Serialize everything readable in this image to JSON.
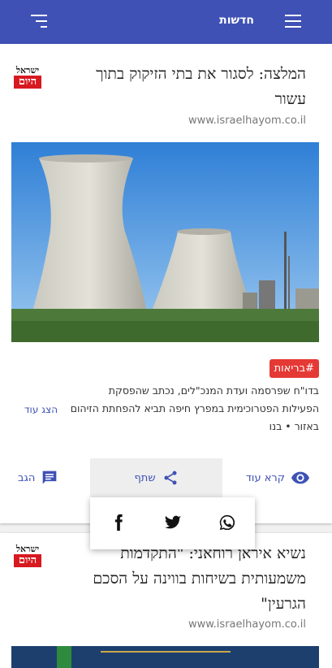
{
  "header": {
    "title": "חדשות",
    "menu_icon": "hamburger-menu-icon",
    "sort_icon": "sort-icon",
    "bar_color": "#3f51b5"
  },
  "articles": [
    {
      "headline_line1": "המלצה: לסגור את בתי הזיקוק בתוך",
      "headline_line2": "עשור",
      "source": "www.israelhayom.co.il",
      "logo_top": "ישראל",
      "logo_bottom": "היום",
      "tag": "#בריאות",
      "snippet": "בדו\"ח שפרסמה ועדת המנכ\"לים, נכתב שהפסקת הפעילות הפטרוכימית במפרץ חיפה תביא להפחתת הזיהום באזור • בנו",
      "show_more": "הצג עוד",
      "actions": {
        "read_more": "קרא עוד",
        "share": "שתף",
        "comment": "הגב"
      }
    },
    {
      "headline_line1": "נשיא איראן רוחאני: \"התקדמות",
      "headline_line2": "משמעותית בשיחות בווינה על הסכם",
      "headline_line3": "הגרעין\"",
      "source": "www.israelhayom.co.il",
      "logo_top": "ישראל",
      "logo_bottom": "היום"
    }
  ],
  "share_popup": {
    "icons": [
      "facebook-icon",
      "twitter-icon",
      "whatsapp-icon"
    ]
  },
  "colors": {
    "accent": "#3f51b5",
    "tag": "#e53935",
    "logo_red": "#d71920"
  }
}
